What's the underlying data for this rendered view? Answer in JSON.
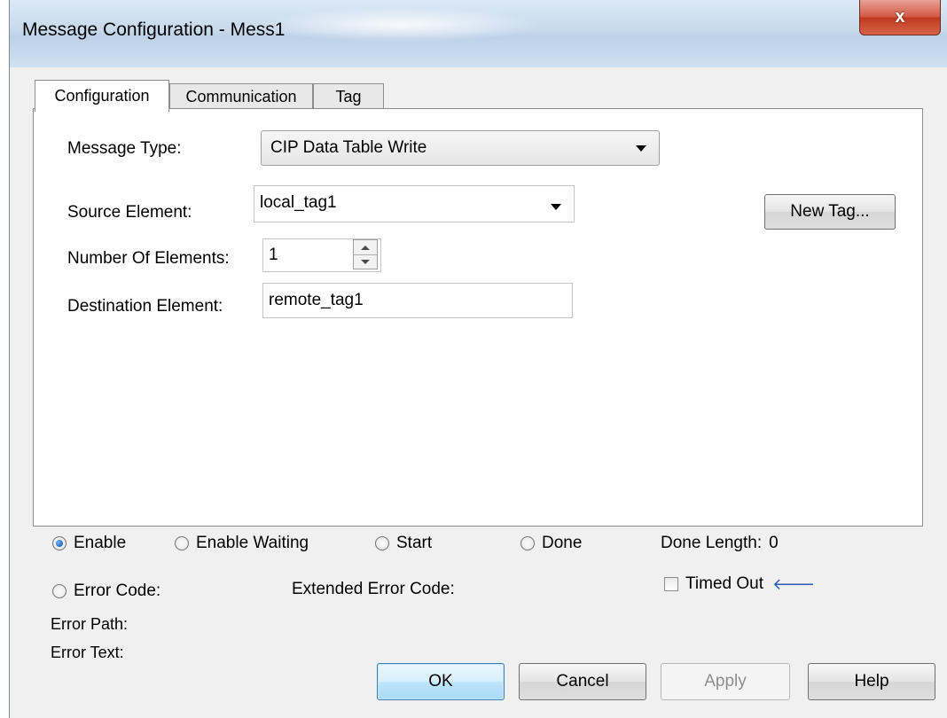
{
  "window": {
    "title": "Message Configuration - Mess1",
    "close_glyph": "x"
  },
  "tabs": [
    {
      "label": "Configuration",
      "active": true
    },
    {
      "label": "Communication",
      "active": false
    },
    {
      "label": "Tag",
      "active": false
    }
  ],
  "config": {
    "message_type_label": "Message Type:",
    "message_type_value": "CIP Data Table Write",
    "source_element_label": "Source Element:",
    "source_element_value": "local_tag1",
    "number_of_elements_label": "Number Of Elements:",
    "number_of_elements_value": "1",
    "destination_element_label": "Destination Element:",
    "destination_element_value": "remote_tag1",
    "new_tag_label": "New Tag..."
  },
  "status": {
    "enable_label": "Enable",
    "enable_waiting_label": "Enable Waiting",
    "start_label": "Start",
    "done_label": "Done",
    "done_length_label": "Done Length:",
    "done_length_value": "0",
    "error_code_label": "Error Code:",
    "extended_error_code_label": "Extended Error Code:",
    "timed_out_label": "Timed Out",
    "error_path_label": "Error Path:",
    "error_text_label": "Error Text:",
    "enable_checked": true
  },
  "buttons": {
    "ok": "OK",
    "cancel": "Cancel",
    "apply": "Apply",
    "help": "Help"
  },
  "icons": {
    "timed_out_arrow": "left-arrow-icon"
  },
  "colors": {
    "title_bar": "#c7d9ec",
    "close_button": "#c9472f",
    "radio_selected": "#1c5fb8",
    "arrow_blue": "#2a5db0"
  }
}
